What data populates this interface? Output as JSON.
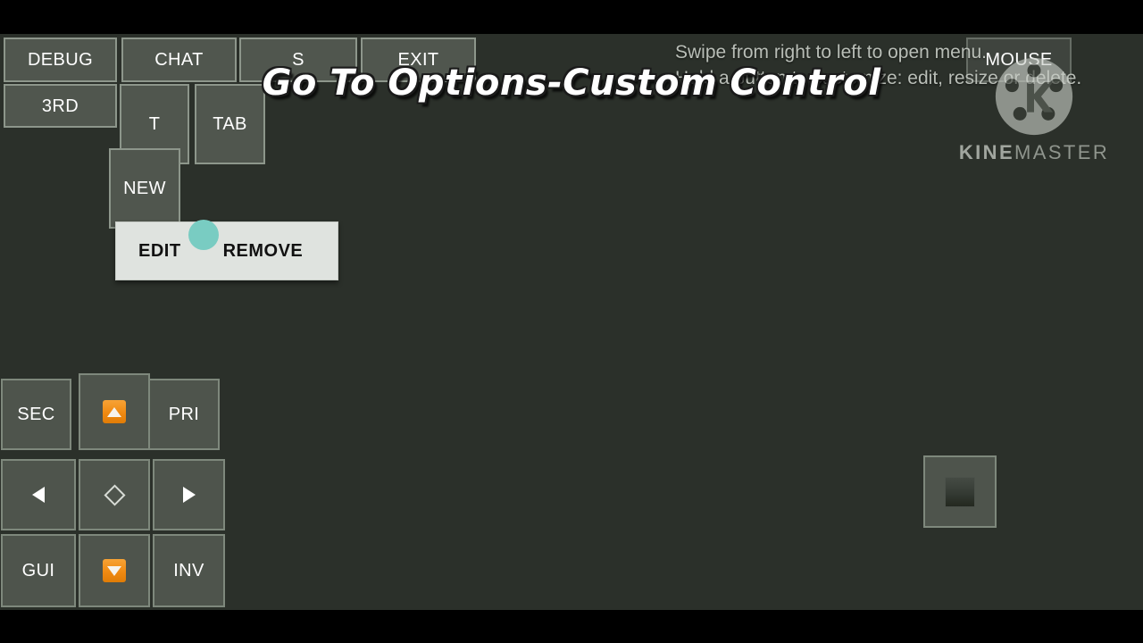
{
  "app": {
    "background_color": "#2b302a",
    "letterbox_color": "#000000",
    "button_face_color": "#50564e",
    "button_border_color": "#8d968b",
    "accent_orange": "#f08a12",
    "touch_indicator_color": "#79ccc2"
  },
  "title_overlay": {
    "text": "Go To Options-Custom Control"
  },
  "hint": {
    "line1": "Swipe from right to left to open menu.",
    "line2": "Hold a button to customize: edit, resize or delete."
  },
  "watermark": {
    "logo_icon": "kinemaster-film-reel-icon",
    "name_bold": "KINE",
    "name_light": "MASTER"
  },
  "controls": {
    "top_row": [
      {
        "id": "debug",
        "label": "DEBUG",
        "icon": null
      },
      {
        "id": "chat",
        "label": "CHAT",
        "icon": null
      },
      {
        "id": "s",
        "label": "S",
        "icon": null
      },
      {
        "id": "exit",
        "label": "EXIT",
        "icon": null
      },
      {
        "id": "mouse",
        "label": "MOUSE",
        "icon": null
      }
    ],
    "second_row": [
      {
        "id": "3rd",
        "label": "3RD",
        "icon": null
      },
      {
        "id": "t",
        "label": "T",
        "icon": null
      },
      {
        "id": "tab",
        "label": "TAB",
        "icon": null
      }
    ],
    "third_row": [
      {
        "id": "new",
        "label": "NEW",
        "icon": null
      }
    ],
    "dpad": [
      {
        "id": "sec",
        "label": "SEC",
        "icon": null
      },
      {
        "id": "up",
        "label": "",
        "icon": "arrow-up-icon"
      },
      {
        "id": "pri",
        "label": "PRI",
        "icon": null
      },
      {
        "id": "left",
        "label": "",
        "icon": "arrow-left-icon"
      },
      {
        "id": "center",
        "label": "",
        "icon": "diamond-icon"
      },
      {
        "id": "right",
        "label": "",
        "icon": "arrow-right-icon"
      },
      {
        "id": "gui",
        "label": "GUI",
        "icon": null
      },
      {
        "id": "down",
        "label": "",
        "icon": "arrow-down-icon"
      },
      {
        "id": "inv",
        "label": "INV",
        "icon": null
      }
    ],
    "right_pad": {
      "id": "jump",
      "label": "",
      "icon": "square-icon"
    }
  },
  "context_menu": {
    "edit_label": "EDIT",
    "remove_label": "REMOVE"
  }
}
